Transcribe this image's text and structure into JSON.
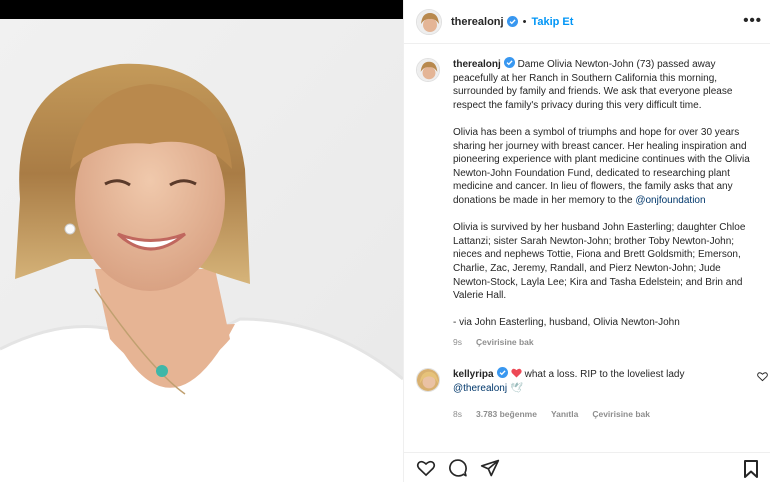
{
  "post": {
    "username": "therealonj",
    "follow_label": "Takip Et",
    "separator": "•",
    "more_label": "•••"
  },
  "caption": {
    "username": "therealonj",
    "para1": "Dame Olivia Newton-John (73) passed away peacefully at her Ranch in Southern California this morning, surrounded by family and friends. We ask that everyone please respect the family's privacy during this very difficult time.",
    "para2": "Olivia has been a symbol of triumphs and hope for over 30 years sharing her journey with breast cancer. Her healing inspiration and pioneering experience with plant medicine continues with the Olivia Newton-John Foundation Fund, dedicated to researching plant medicine and cancer. In lieu of flowers, the family asks that any donations be made in her memory to the",
    "mention": "@onjfoundation",
    "para3": "Olivia is survived by her husband John Easterling; daughter Chloe Lattanzi; sister Sarah Newton-John; brother Toby Newton-John; nieces and nephews Tottie, Fiona and Brett Goldsmith; Emerson, Charlie, Zac, Jeremy, Randall, and Pierz Newton-John; Jude Newton-Stock, Layla Lee; Kira and Tasha Edelstein; and Brin and Valerie Hall.",
    "para4": "- via John Easterling, husband, Olivia Newton-John",
    "time": "9s",
    "translate_label": "Çevirisine bak"
  },
  "reply": {
    "username": "kellyripa",
    "text": "what a loss. RIP to the loveliest lady",
    "mention": "@therealonj",
    "emoji": "🕊",
    "time": "8s",
    "likes": "3.783 beğenme",
    "reply_label": "Yanıtla",
    "translate_label": "Çevirisine bak"
  },
  "colors": {
    "accent": "#0095f6",
    "verified": "#3897f0",
    "heart_red": "#ed4956",
    "link": "#00376b"
  },
  "icons": [
    "heart-icon",
    "comment-icon",
    "share-icon",
    "bookmark-icon",
    "verified-icon",
    "more-icon"
  ]
}
